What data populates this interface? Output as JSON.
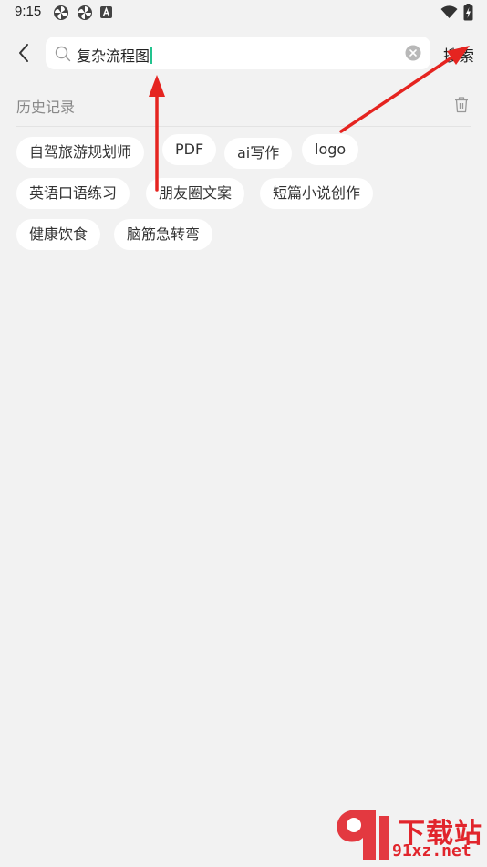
{
  "status_bar": {
    "time": "9:15",
    "icons_left": [
      "fan-icon",
      "fan-icon",
      "font-a-icon"
    ],
    "icons_right": [
      "wifi-icon",
      "battery-icon"
    ]
  },
  "search": {
    "query": "复杂流程图",
    "submit_label": "搜索",
    "cursor_color": "#22c38e"
  },
  "history": {
    "title": "历史记录",
    "items": [
      "自驾旅游规划师",
      "PDF",
      "ai写作",
      "logo",
      "英语口语练习",
      "朋友圈文案",
      "短篇小说创作",
      "健康饮食",
      "脑筋急转弯"
    ]
  },
  "annotations": {
    "arrow_color": "#e52420"
  },
  "watermark": {
    "logo_text": "下载站",
    "url_text": "91xz.net",
    "color": "#e1252c"
  }
}
